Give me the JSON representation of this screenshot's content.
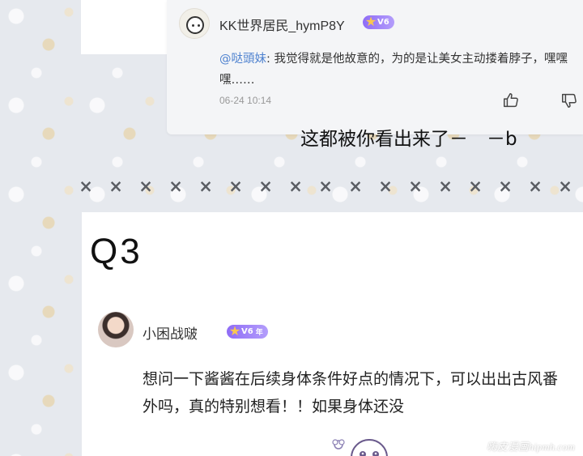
{
  "reply_comment": {
    "username": "KK世界居民_hymP8Y",
    "level": "V6",
    "mention": "@哒頭妹",
    "text": ": 我觉得就是他故意的，为的是让美女主动搂着脖子，嘿嘿嘿……",
    "timestamp": "06-24 10:14",
    "like_icon": "thumbs-up-icon",
    "dislike_icon": "thumbs-down-icon"
  },
  "caption": "这都被你看出来了－　－b",
  "separator": {
    "marks": [
      "×",
      "×",
      "×",
      "×",
      "×",
      "×",
      "×",
      "×",
      "×",
      "×",
      "×",
      "×",
      "×",
      "×",
      "×",
      "×",
      "×"
    ]
  },
  "question": {
    "title": "Q3",
    "username": "小困战啵",
    "level": "V6",
    "year_tag": "年",
    "text": "想问一下酱酱在后续身体条件好点的情况下，可以出出古风番外吗，真的特别想看！！如果身体还没"
  },
  "watermark": "嗨皮漫画hipmh.com",
  "colors": {
    "mention": "#4d81cf",
    "badge_start": "#8f6cf6",
    "badge_end": "#b39dfb",
    "page_background": "#e6e9ee"
  }
}
